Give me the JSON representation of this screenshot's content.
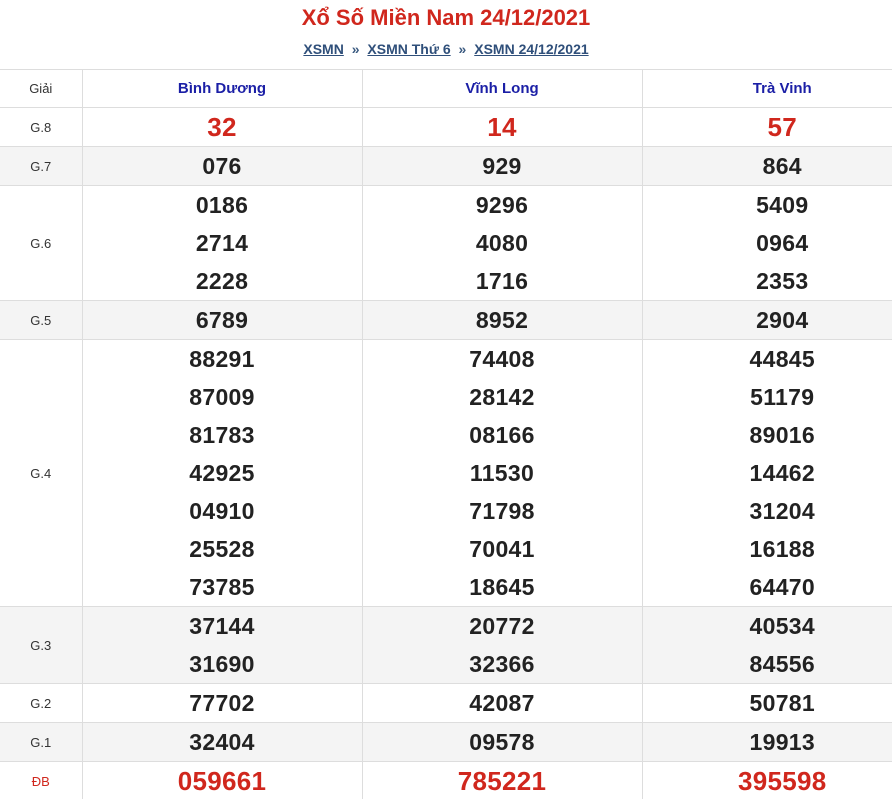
{
  "header": {
    "title": "Xổ Số Miền Nam 24/12/2021",
    "breadcrumb": [
      {
        "label": "XSMN"
      },
      {
        "label": "XSMN Thứ 6"
      },
      {
        "label": "XSMN 24/12/2021"
      }
    ],
    "separator": "»"
  },
  "table": {
    "prize_header": "Giải",
    "provinces": [
      "Bình Dương",
      "Vĩnh Long",
      "Trà Vinh"
    ],
    "rows": [
      {
        "prize": "G.8",
        "style": "red",
        "values": [
          [
            "32"
          ],
          [
            "14"
          ],
          [
            "57"
          ]
        ]
      },
      {
        "prize": "G.7",
        "style": "normal",
        "values": [
          [
            "076"
          ],
          [
            "929"
          ],
          [
            "864"
          ]
        ]
      },
      {
        "prize": "G.6",
        "style": "normal",
        "values": [
          [
            "0186",
            "2714",
            "2228"
          ],
          [
            "9296",
            "4080",
            "1716"
          ],
          [
            "5409",
            "0964",
            "2353"
          ]
        ]
      },
      {
        "prize": "G.5",
        "style": "normal",
        "values": [
          [
            "6789"
          ],
          [
            "8952"
          ],
          [
            "2904"
          ]
        ]
      },
      {
        "prize": "G.4",
        "style": "normal",
        "values": [
          [
            "88291",
            "87009",
            "81783",
            "42925",
            "04910",
            "25528",
            "73785"
          ],
          [
            "74408",
            "28142",
            "08166",
            "11530",
            "71798",
            "70041",
            "18645"
          ],
          [
            "44845",
            "51179",
            "89016",
            "14462",
            "31204",
            "16188",
            "64470"
          ]
        ]
      },
      {
        "prize": "G.3",
        "style": "normal",
        "values": [
          [
            "37144",
            "31690"
          ],
          [
            "20772",
            "32366"
          ],
          [
            "40534",
            "84556"
          ]
        ]
      },
      {
        "prize": "G.2",
        "style": "normal",
        "values": [
          [
            "77702"
          ],
          [
            "42087"
          ],
          [
            "50781"
          ]
        ]
      },
      {
        "prize": "G.1",
        "style": "normal",
        "values": [
          [
            "32404"
          ],
          [
            "09578"
          ],
          [
            "19913"
          ]
        ]
      },
      {
        "prize": "ĐB",
        "style": "db",
        "values": [
          [
            "059661"
          ],
          [
            "785221"
          ],
          [
            "395598"
          ]
        ]
      }
    ]
  },
  "colors": {
    "accent_red": "#d0271d",
    "province_blue": "#1b1fa6",
    "link": "#2f4f7a",
    "alt_row": "#f4f4f4"
  }
}
